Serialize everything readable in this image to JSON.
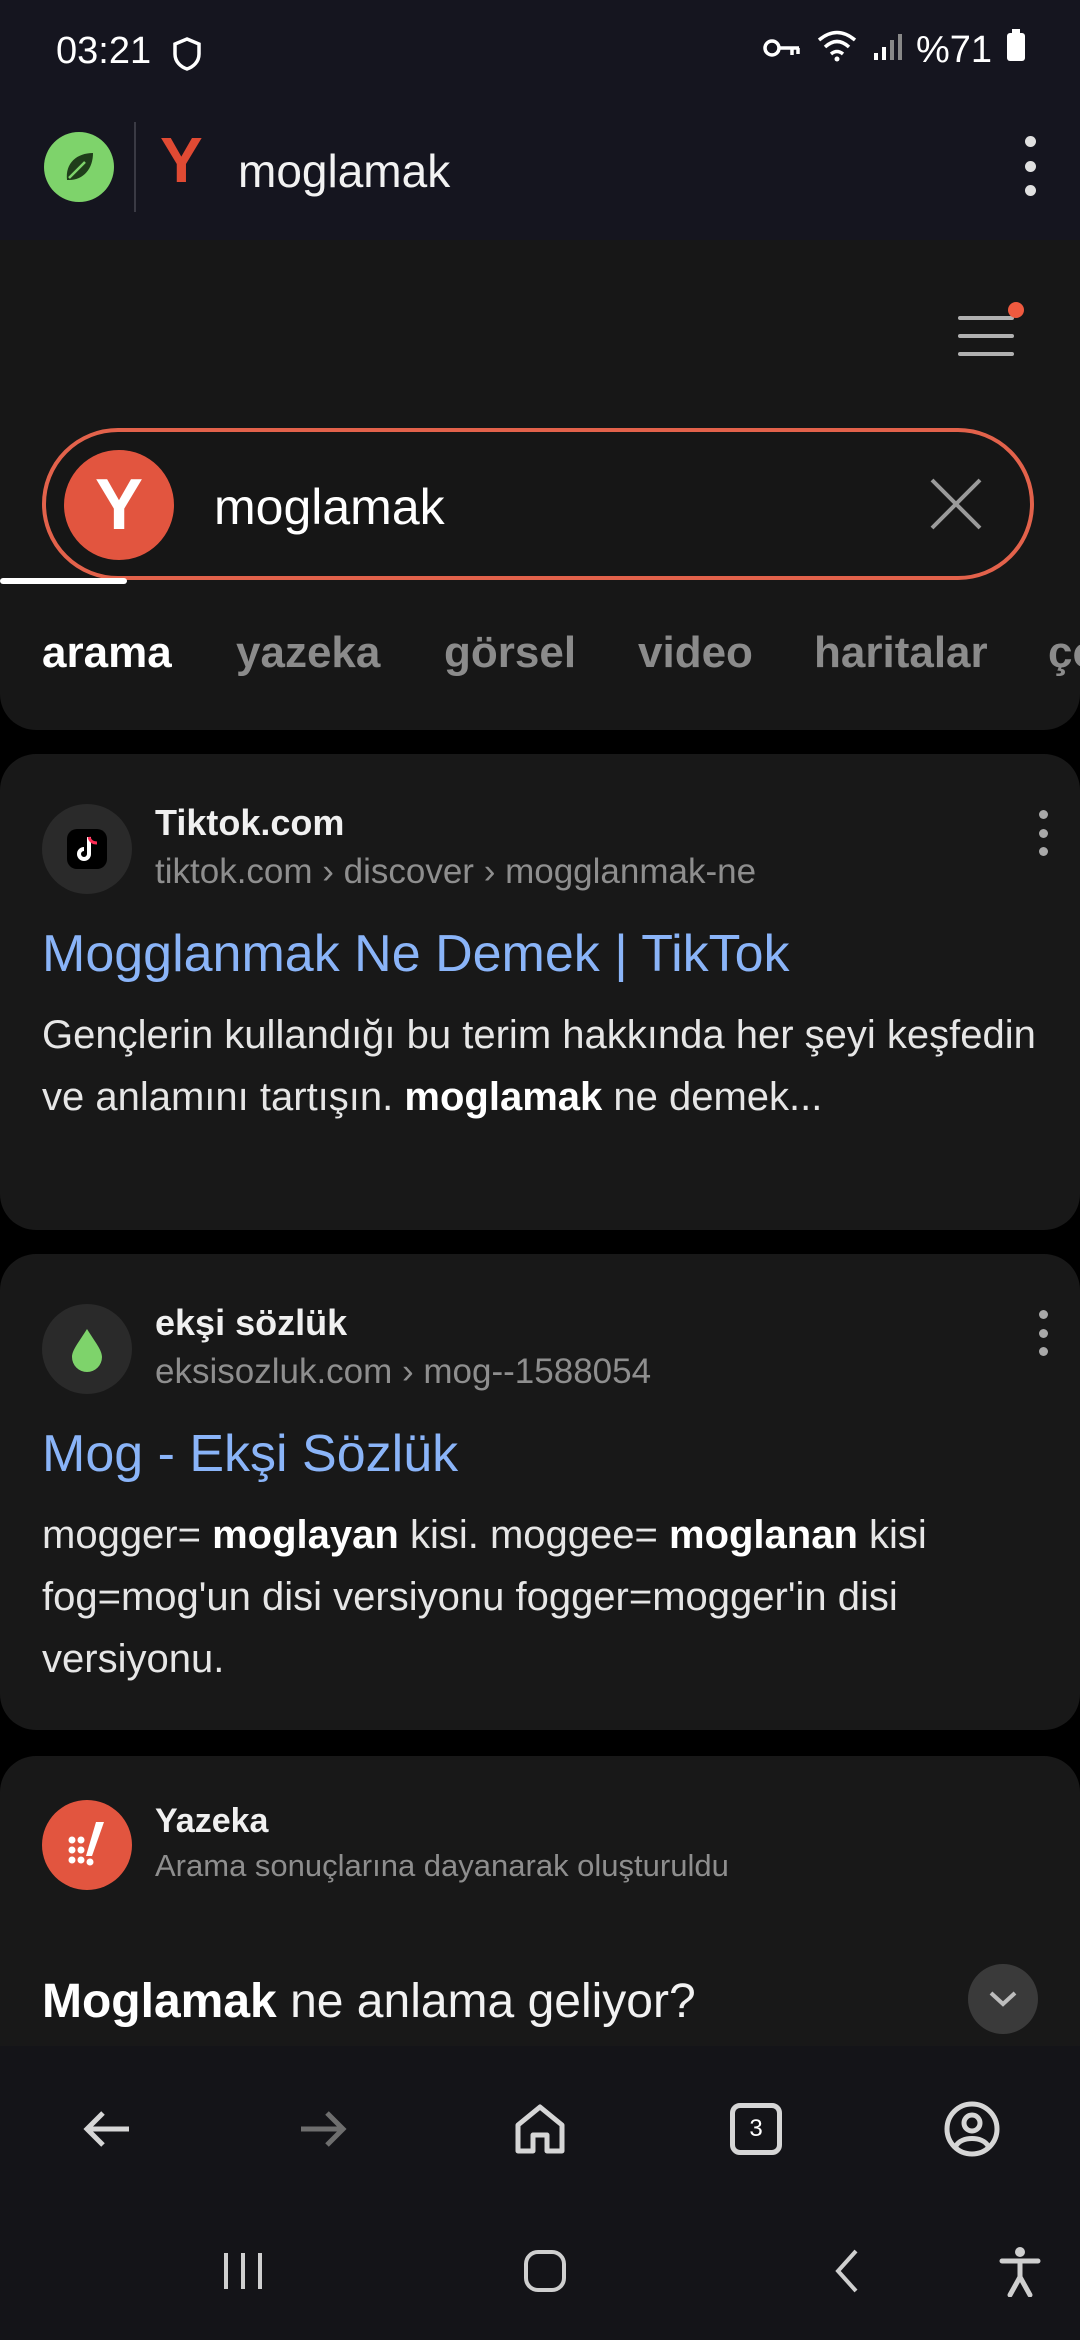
{
  "status_bar": {
    "time": "03:21",
    "battery": "%71"
  },
  "browser": {
    "address": "moglamak"
  },
  "search": {
    "query": "moglamak",
    "tabs": [
      "arama",
      "yazeka",
      "görsel",
      "video",
      "haritalar",
      "ço"
    ]
  },
  "results": [
    {
      "site": "Tiktok.com",
      "url": "tiktok.com › discover › mogglanmak-ne",
      "title": "Mogglanmak Ne Demek | TikTok",
      "snippet_a": "Gençlerin kullandığı bu terim hakkında her şeyi keşfedin ve anlamını tartışın.",
      "snippet_bold": "moglamak",
      "snippet_b": "ne demek..."
    },
    {
      "site": "ekşi sözlük",
      "url": "eksisozluk.com › mog--1588054",
      "title": "Mog - Ekşi Sözlük",
      "s1": "mogger=",
      "s1b": "moglayan",
      "s2": "kisi. moggee=",
      "s2b": "moglanan",
      "s3": "kisi fog=mog'un disi versiyonu fogger=mogger'in disi versiyonu."
    }
  ],
  "yazeka": {
    "name": "Yazeka",
    "subtitle": "Arama sonuçlarına dayanarak oluşturuldu",
    "question_bold": "Moglamak",
    "question_rest": "ne anlama geliyor?"
  },
  "bottom_nav": {
    "tab_count": "3"
  },
  "icons": [
    "shield-icon",
    "key-icon",
    "wifi-icon",
    "signal-icon",
    "battery-icon",
    "leaf-icon",
    "yandex-icon",
    "more-icon",
    "menu-icon",
    "close-icon",
    "tiktok-icon",
    "drop-icon",
    "chevron-down-icon",
    "back-icon",
    "forward-icon",
    "home-icon",
    "tabs-icon",
    "account-icon",
    "recents-icon",
    "system-home-icon",
    "system-back-icon",
    "accessibility-icon"
  ],
  "colors": {
    "accent": "#e3624b",
    "link": "#8ab4f8",
    "leaf": "#7ed36b"
  }
}
